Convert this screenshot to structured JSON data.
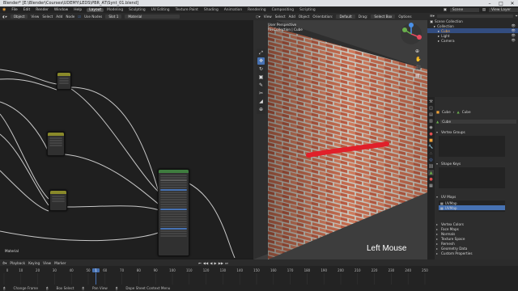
{
  "window": {
    "title": "Blender* [E:\\Blender\\Courses\\UDEMY\\LEDS\\PBR_AT\\Synt_01.blend]",
    "minimize": "–",
    "maximize": "□",
    "close": "✕"
  },
  "menu": {
    "items": [
      "File",
      "Edit",
      "Render",
      "Window",
      "Help"
    ],
    "workspace_tabs": [
      "Layout",
      "Modeling",
      "Sculpting",
      "UV Editing",
      "Texture Paint",
      "Shading",
      "Animation",
      "Rendering",
      "Compositing",
      "Scripting"
    ],
    "active_tab": "Layout",
    "scene_label": "Scene",
    "view_layer_label": "View Layer"
  },
  "node_editor": {
    "header": {
      "object": "Object",
      "view": "View",
      "select": "Select",
      "add": "Add",
      "node": "Node",
      "use_nodes": "Use Nodes",
      "slot": "Slot 1",
      "material": "Material"
    },
    "footer_label": "Material"
  },
  "viewport": {
    "header": {
      "view": "View",
      "select": "Select",
      "add": "Add",
      "object": "Object",
      "orientation_label": "Orientation:",
      "orientation_value": "Default",
      "drag": "Drag:",
      "drag_value": "Select Box",
      "options": "Options"
    },
    "view_name": "User Perspective",
    "collection_label": "(1) Collection | Cube",
    "overlay_text": "Left Mouse",
    "tools": [
      "⤢",
      "✥",
      "↻",
      "▣",
      "✎",
      "✂",
      "◢",
      "⊕"
    ],
    "active_tool_index": 1
  },
  "outliner": {
    "title": "Scene Collection",
    "items": [
      {
        "label": "Collection",
        "indent": 1,
        "selected": false,
        "color": "#cfcfcf"
      },
      {
        "label": "Cube",
        "indent": 2,
        "selected": true,
        "color": "#f0a33a"
      },
      {
        "label": "Light",
        "indent": 2,
        "selected": false,
        "color": "#cfcfcf"
      },
      {
        "label": "Camera",
        "indent": 2,
        "selected": false,
        "color": "#cfcfcf"
      }
    ]
  },
  "properties": {
    "object_name": "Cube",
    "data_name": "Cube",
    "mesh_name": "Cube",
    "panels": [
      "Vertex Groups",
      "Shape Keys",
      "UV Maps",
      "Vertex Colors",
      "Face Maps",
      "Normals",
      "Texture Space",
      "Remesh",
      "Geometry Data",
      "Custom Properties"
    ],
    "uv_maps": [
      "UVMap",
      "UVMap"
    ]
  },
  "timeline": {
    "header": {
      "playback": "Playback",
      "keying": "Keying",
      "view": "View",
      "marker": "Marker"
    },
    "current_frame": "1",
    "ticks": [
      "0",
      "10",
      "20",
      "30",
      "40",
      "50",
      "60",
      "70",
      "80",
      "90",
      "100",
      "110",
      "120",
      "130",
      "140",
      "150",
      "160",
      "170",
      "180",
      "190",
      "200",
      "210",
      "220",
      "230",
      "240",
      "250"
    ]
  },
  "statusbar": {
    "items": [
      "Change Frame",
      "Box Select",
      "Pan View",
      "Dope Sheet Context Menu"
    ]
  },
  "colors": {
    "accent": "#4772b3",
    "active_object": "#f0a33a",
    "brush_stroke": "#e0202a",
    "node_header_green": "#3f7d3f",
    "node_header_yellow": "#8a8a2a"
  }
}
